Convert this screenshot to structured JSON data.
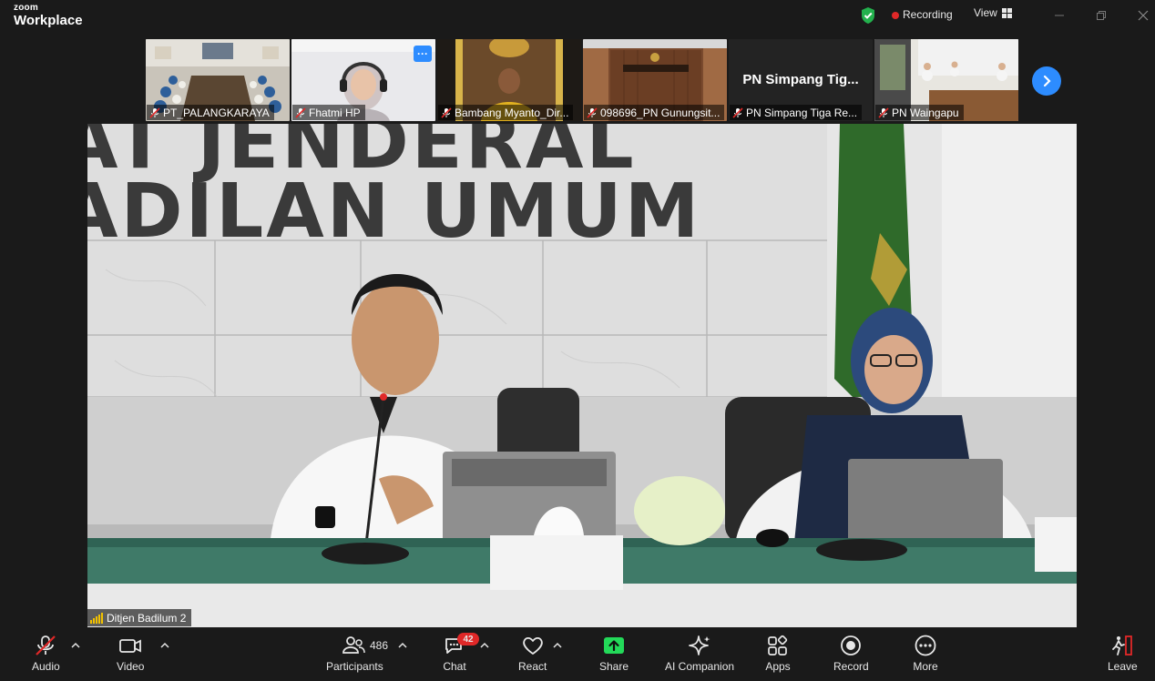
{
  "app": {
    "brand_small": "zoom",
    "brand_big": "Workplace",
    "recording_label": "Recording",
    "view_label": "View"
  },
  "participants_strip": [
    {
      "name": "PT_PALANGKARAYA",
      "muted": true
    },
    {
      "name": "Fhatmi HP",
      "muted": true
    },
    {
      "name": "Bambang Myanto_Dir...",
      "muted": true
    },
    {
      "name": "098696_PN Gunungsit...",
      "muted": true
    },
    {
      "name": "PN Simpang Tiga Re...",
      "muted": true,
      "display_name": "PN Simpang Tig..."
    },
    {
      "name": "PN Waingapu",
      "muted": true
    }
  ],
  "main_video": {
    "speaker_label": "Ditjen Badilum 2",
    "backdrop_line1": "AT JENDERAL",
    "backdrop_line2": "ADILAN UMUM"
  },
  "toolbar": {
    "audio": "Audio",
    "video": "Video",
    "participants": "Participants",
    "participants_count": "486",
    "chat": "Chat",
    "chat_badge": "42",
    "react": "React",
    "share": "Share",
    "ai_companion": "AI Companion",
    "apps": "Apps",
    "record": "Record",
    "more": "More",
    "leave": "Leave"
  },
  "colors": {
    "accent_blue": "#2d8cff",
    "record_red": "#e02828",
    "share_green": "#23d959",
    "background": "#1a1a1a"
  }
}
